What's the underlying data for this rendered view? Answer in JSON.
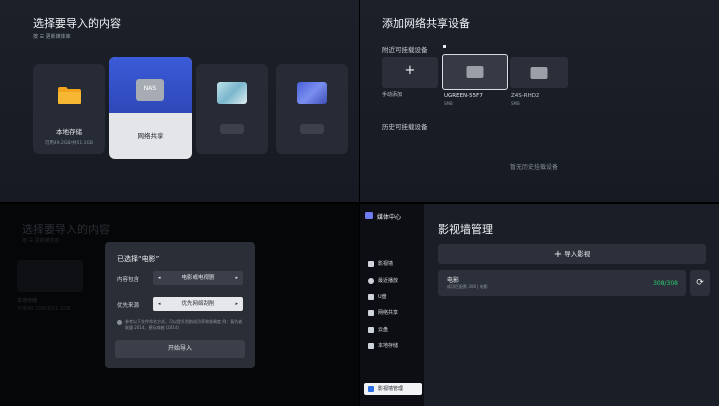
{
  "p1": {
    "title": "选择要导入的内容",
    "hint": "按 ☰ 更新媒体库",
    "cards": [
      {
        "label": "本地存储",
        "sub": "可用49.2GB/共51.1GB",
        "icon": "folder-icon"
      },
      {
        "label": "网络共享",
        "icon": "nas-icon"
      }
    ],
    "nas_text": "NAS"
  },
  "p2": {
    "title": "添加网络共享设备",
    "nearby_label": "附近可挂载设备",
    "add_label": "手动添加",
    "devices": [
      {
        "name": "UGREEN-55F7",
        "type": "SMB",
        "icon": "nas-device-icon"
      },
      {
        "name": "Z4S-RHD2",
        "type": "SMB",
        "icon": "nas-device-icon"
      }
    ],
    "history_label": "历史可挂载设备",
    "history_empty": "暂无历史挂载设备"
  },
  "p3": {
    "bg_title": "选择要导入的内容",
    "bg_hint": "按 ☰ 更新媒体库",
    "bg_card_label": "本地存储",
    "bg_card_sub": "可用49.2GB/共51.1GB",
    "dialog": {
      "title": "已选择“电影”",
      "content_label": "内容包含",
      "content_value": "电影或电视剧",
      "source_label": "优先来源",
      "source_value": "优先网络刮削",
      "note": "参考以下文件命名方式，可以提升刮削成功率和准确度 例：复仇者联盟 2014、星际穿越 (2014)",
      "start_button": "开始导入"
    }
  },
  "p4": {
    "app_title": "媒体中心",
    "nav": [
      {
        "label": "影视墙",
        "icon": "tv-icon"
      },
      {
        "label": "最近播放",
        "icon": "clock-icon"
      },
      {
        "label": "U盘",
        "icon": "usb-icon"
      },
      {
        "label": "网络共享",
        "icon": "network-icon"
      },
      {
        "label": "云盘",
        "icon": "cloud-icon"
      },
      {
        "label": "本地存储",
        "icon": "storage-icon"
      }
    ],
    "active_nav": "影视墙管理",
    "page_title": "影视墙管理",
    "import_button": "导入影视",
    "item": {
      "title": "电影",
      "sub": "成功匹配数 308 | 电影",
      "count": "308/308"
    },
    "accent": "#2ecc71"
  }
}
